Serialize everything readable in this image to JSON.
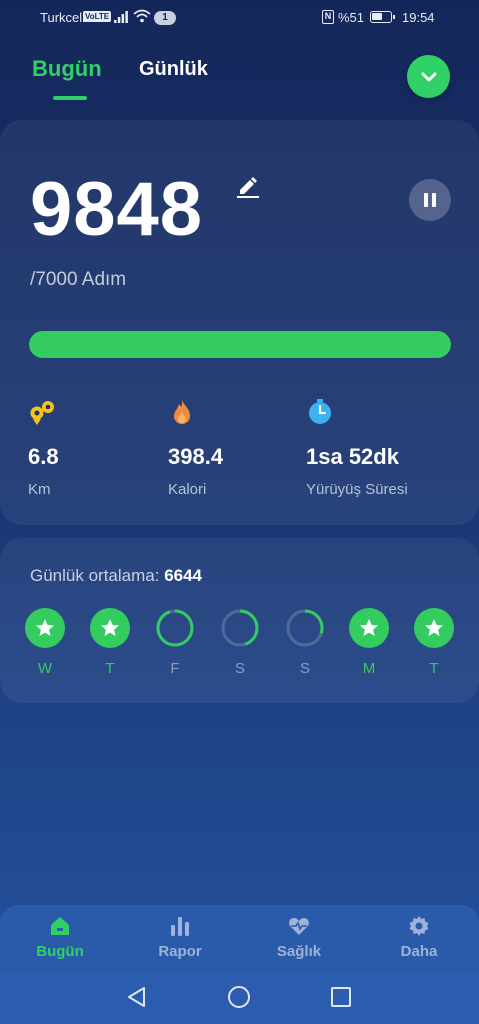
{
  "status_bar": {
    "carrier": "Turkcell",
    "volte": "VoLTE",
    "notifications": "1",
    "nfc": "N",
    "battery": "%51",
    "time": "19:54"
  },
  "tabs": {
    "today": "Bugün",
    "daily": "Günlük"
  },
  "steps": {
    "count": "9848",
    "goal": "/7000 Adım",
    "progress_fraction": 1.0
  },
  "metrics": [
    {
      "icon": "distance-icon",
      "value": "6.8",
      "label": "Km"
    },
    {
      "icon": "flame-icon",
      "value": "398.4",
      "label": "Kalori"
    },
    {
      "icon": "stopwatch-icon",
      "value": "1sa 52dk",
      "label": "Yürüyüş Süresi"
    }
  ],
  "weekly": {
    "avg_label": "Günlük ortalama: ",
    "avg_value": "6644",
    "days": [
      {
        "letter": "W",
        "status": "complete"
      },
      {
        "letter": "T",
        "status": "complete"
      },
      {
        "letter": "F",
        "status": "partial",
        "fraction": 0.95
      },
      {
        "letter": "S",
        "status": "partial",
        "fraction": 0.45
      },
      {
        "letter": "S",
        "status": "partial",
        "fraction": 0.3
      },
      {
        "letter": "M",
        "status": "complete"
      },
      {
        "letter": "T",
        "status": "complete"
      }
    ]
  },
  "bottom_nav": {
    "today": "Bugün",
    "report": "Rapor",
    "health": "Sağlık",
    "more": "Daha"
  },
  "colors": {
    "accent": "#34cc5f",
    "background": "#1a3570",
    "nav": "#2a5aaa"
  }
}
